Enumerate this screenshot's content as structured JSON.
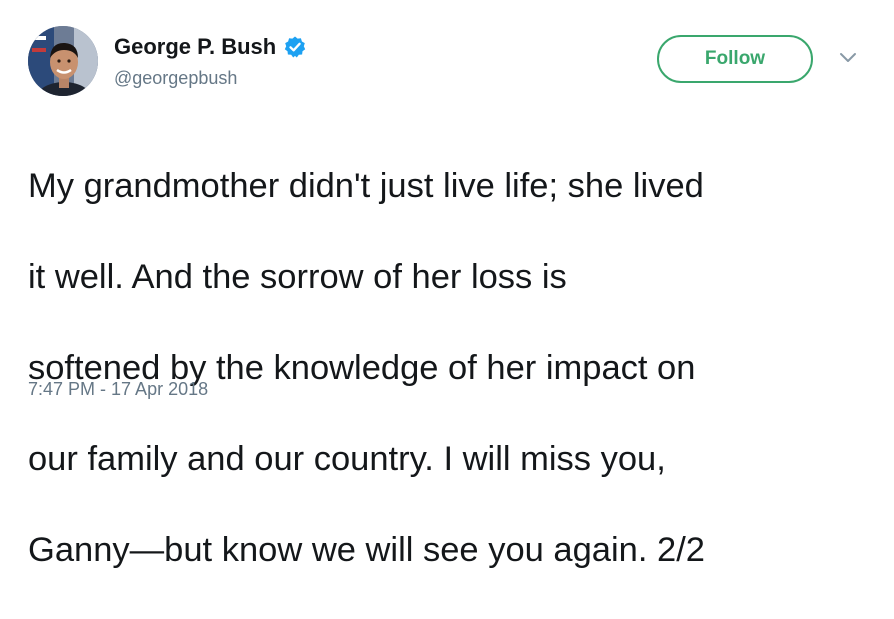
{
  "author": {
    "display_name": "George P. Bush",
    "handle": "@georgepbush",
    "verified": true,
    "avatar_icon": "profile-photo"
  },
  "actions": {
    "follow_label": "Follow",
    "more_icon": "chevron-down-icon"
  },
  "tweet": {
    "text_lines": [
      "My grandmother didn't just live life; she lived",
      "it well.  And the sorrow of her loss is",
      "softened by the knowledge of her impact on",
      "our family and our country.  I will miss you,",
      "Ganny—but know we will see you again. 2/2"
    ],
    "timestamp": "7:47 PM - 17 Apr 2018"
  },
  "colors": {
    "follow_accent": "#3aa76d",
    "verified_badge": "#1da1f2",
    "text_primary": "#14171a",
    "text_secondary": "#657786"
  }
}
